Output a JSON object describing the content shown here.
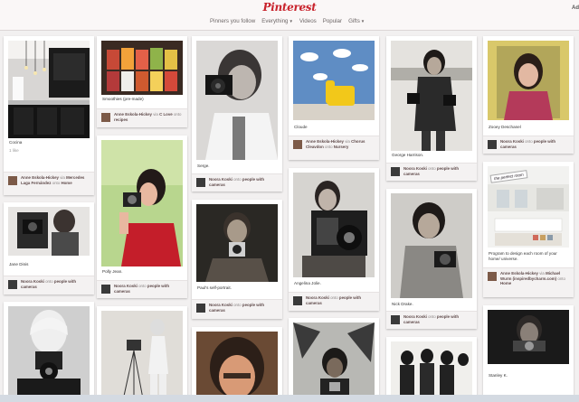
{
  "header": {
    "logo": "Pinterest",
    "nav": [
      "Pinners you follow",
      "Everything",
      "Videos",
      "Popular",
      "Gifts"
    ],
    "add_label": "Ad"
  },
  "pins": {
    "cocina": {
      "desc": "Cocina",
      "likes": "1 like",
      "user": "Anne Eskola-Hickey",
      "via": "via",
      "via_user": "Mercedes Laga Fernández",
      "onto": "onto",
      "board": "Home"
    },
    "smoothies": {
      "desc": "Smoothies (pre-made)",
      "user": "Anne Eskola-Hickey",
      "via": "via",
      "via_user": "C Love",
      "onto": "onto",
      "board": "recipes"
    },
    "jane_dinis": {
      "desc": "Jane Dinis",
      "user": "Noora Koski",
      "onto": "onto",
      "board": "people with cameras"
    },
    "polly_jean": {
      "desc": "Polly Jean.",
      "user": "Noora Koski",
      "onto": "onto",
      "board": "people with cameras"
    },
    "serge": {
      "desc": "Serge.",
      "user": "Noora Koski",
      "onto": "onto",
      "board": "people with cameras"
    },
    "pauls_self_portrait": {
      "desc": "Paul's self-portrait.",
      "user": "Noora Koski",
      "onto": "onto",
      "board": "people with cameras"
    },
    "cloude": {
      "desc": "Cloude",
      "user": "Anne Eskola-Hickey",
      "via": "via",
      "via_user": "Chorus Cleavdon",
      "onto": "onto",
      "board": "Nursery"
    },
    "angelina_jolie": {
      "desc": "Angelina Jolie.",
      "user": "Noora Koski",
      "onto": "onto",
      "board": "people with cameras"
    },
    "george_harrison": {
      "desc": "George Harrison.",
      "user": "Noora Koski",
      "onto": "onto",
      "board": "people with cameras"
    },
    "nick_drake": {
      "desc": "Nick Drake.",
      "user": "Noora Koski",
      "onto": "onto",
      "board": "people with cameras"
    },
    "zooey_deschanel": {
      "desc": "Zooey Deschanel",
      "user": "Noora Koski",
      "onto": "onto",
      "board": "people with cameras"
    },
    "kitchen_program": {
      "stamp": "the perfect room",
      "desc": "Program to design each room of your home/ universe.",
      "user": "Anne Eskola-Hickey",
      "via": "via",
      "via_user": "Michael Wurm (inspiredbycharm.com)",
      "onto": "onto",
      "board": "Home"
    },
    "stanley_k": {
      "desc": "Stanley K."
    }
  }
}
